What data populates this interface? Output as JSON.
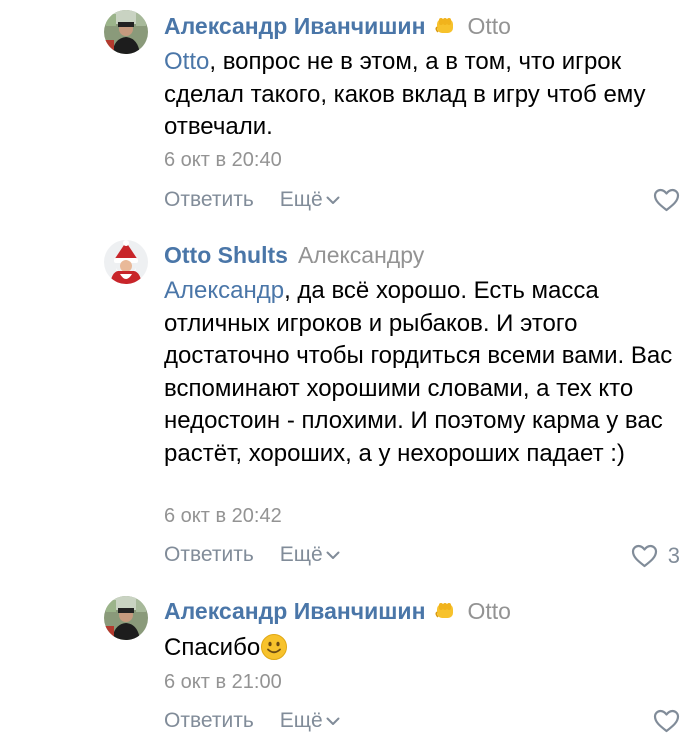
{
  "comments": [
    {
      "author": "Александр Иванчишин",
      "reply_to": "Otto",
      "mention": "Otto",
      "text": ", вопрос не в этом, а в том, что игрок сделал такого, каков вклад в игру чтоб ему отвечали.",
      "date": "6 окт в 20:40",
      "reply_label": "Ответить",
      "more_label": "Ещё",
      "likes": ""
    },
    {
      "author": "Otto Shults",
      "reply_to": "Александру",
      "mention": "Александр",
      "text": ", да всё хорошо. Есть масса отличных игроков и рыбаков. И этого достаточно чтобы гордиться всеми вами. Вас вспоминают хорошими словами, а тех кто недостоин - плохими. И поэтому карма у вас растёт, хороших, а у нехороших падает :)",
      "date": "6 окт в 20:42",
      "reply_label": "Ответить",
      "more_label": "Ещё",
      "likes": "3"
    },
    {
      "author": "Александр Иванчишин",
      "reply_to": "Otto",
      "text": "Спасибо",
      "date": "6 окт в 21:00",
      "reply_label": "Ответить",
      "more_label": "Ещё",
      "likes": ""
    }
  ],
  "colors": {
    "link": "#4a76a8",
    "secondary": "#939393",
    "action": "#818c99",
    "emoji": "#f7c22c"
  },
  "icons": [
    "fist-emoji-icon",
    "chevron-down-icon",
    "heart-icon",
    "smile-emoji-icon"
  ]
}
